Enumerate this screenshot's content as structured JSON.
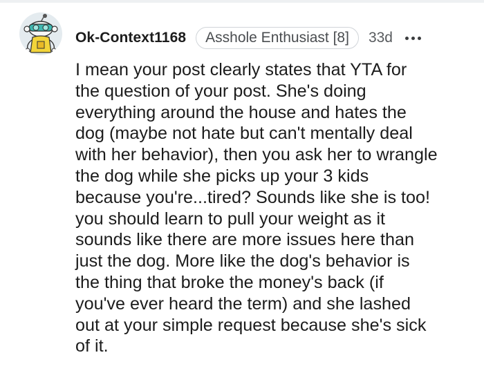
{
  "comment": {
    "username": "Ok-Context1168",
    "flair": "Asshole Enthusiast [8]",
    "age": "33d",
    "avatar_icon": "snoo-avatar-icon",
    "more_icon": "more-options-icon",
    "body_lines": [
      "I mean your post clearly states that YTA for",
      "the question of your post. She's doing",
      "everything around the house and hates the",
      "dog (maybe not hate but can't mentally deal",
      "with her behavior), then you ask her to wrangle",
      "the dog while she picks up your 3 kids",
      "because you're...tired? Sounds like she is too!",
      "you should learn to pull your weight as it",
      "sounds like there are more issues here than",
      "just the dog. More like the dog's behavior is",
      "the thing that broke the money's back (if",
      "you've ever heard the term) and she lashed",
      "out at your simple request because she's sick",
      "of it."
    ]
  },
  "colors": {
    "text": "#1c1c1c",
    "muted": "#575a5d",
    "flair_border": "#d0d4d8"
  }
}
